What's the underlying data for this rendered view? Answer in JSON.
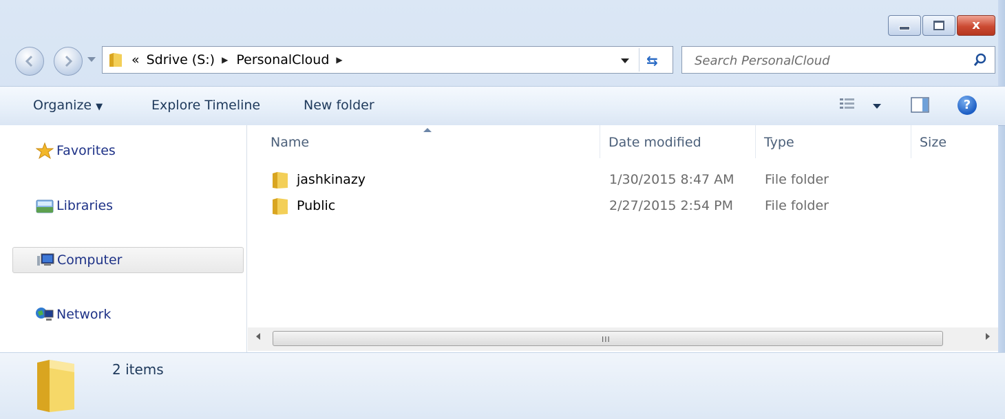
{
  "window": {
    "caption": {
      "minimize_icon": "minimize-icon",
      "maximize_icon": "maximize-icon",
      "close_glyph": "x"
    }
  },
  "address_bar": {
    "overflow": "«",
    "crumbs": [
      "Sdrive (S:)",
      "PersonalCloud"
    ],
    "separator": "▶"
  },
  "search": {
    "placeholder": "Search PersonalCloud",
    "value": ""
  },
  "command_bar": {
    "organize": "Organize",
    "explore_timeline": "Explore Timeline",
    "new_folder": "New folder",
    "help": "?"
  },
  "nav_pane": {
    "items": [
      {
        "label": "Favorites",
        "icon": "star-icon"
      },
      {
        "label": "Libraries",
        "icon": "libraries-icon"
      },
      {
        "label": "Computer",
        "icon": "computer-icon",
        "selected": true
      },
      {
        "label": "Network",
        "icon": "network-icon"
      }
    ]
  },
  "file_list": {
    "columns": [
      "Name",
      "Date modified",
      "Type",
      "Size"
    ],
    "sorted_by": "Name",
    "rows": [
      {
        "name": "jashkinazy",
        "date": "1/30/2015 8:47 AM",
        "type": "File folder",
        "size": ""
      },
      {
        "name": "Public",
        "date": "2/27/2015 2:54 PM",
        "type": "File folder",
        "size": ""
      }
    ]
  },
  "scrollbar": {
    "grip": "III"
  },
  "details_pane": {
    "item_count": "2 items"
  },
  "colors": {
    "link_blue": "#1e3287",
    "chrome": "#dbe7f5",
    "selected_row": "#e9e9e9"
  }
}
